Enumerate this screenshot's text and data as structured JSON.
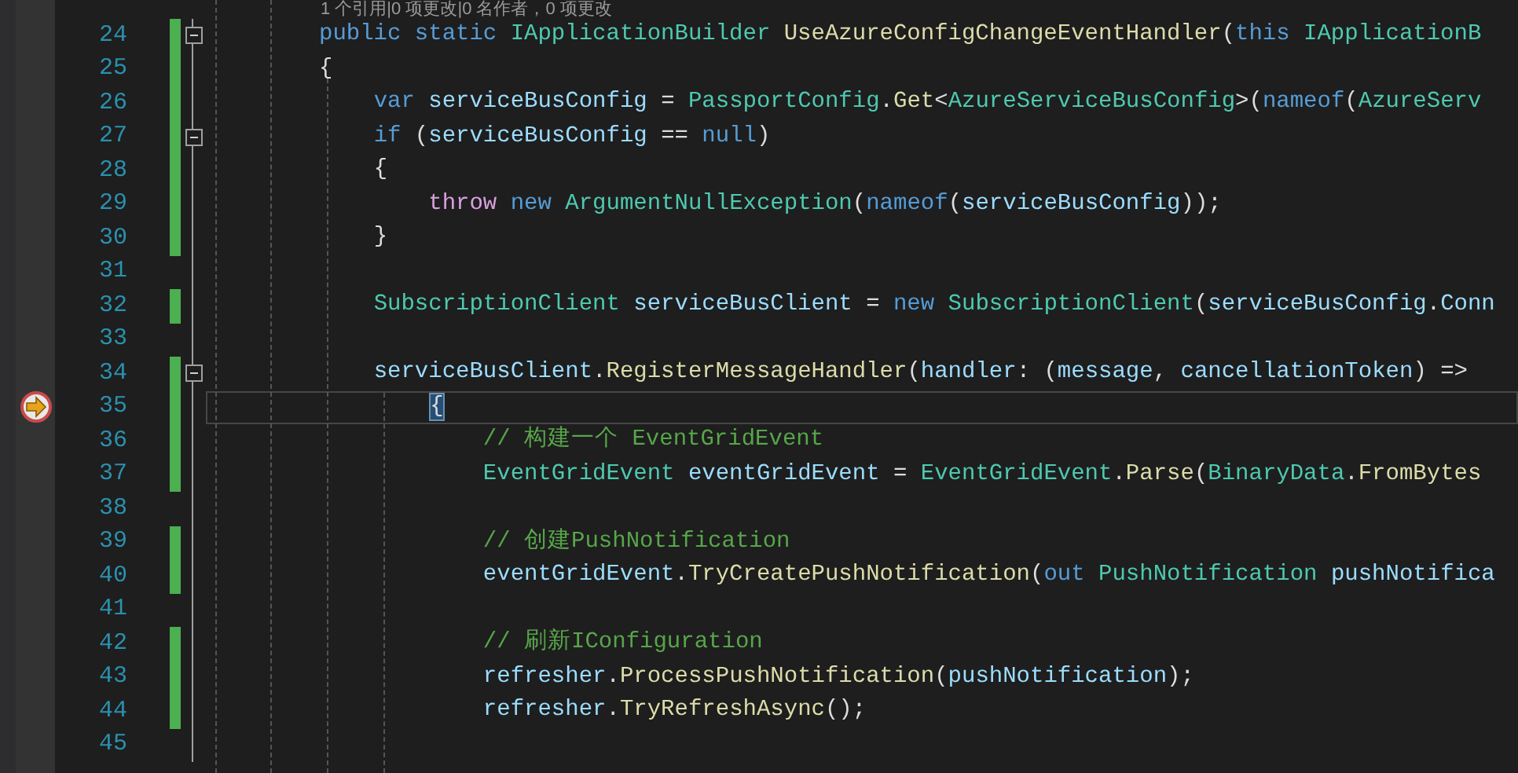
{
  "codelens": "1 个引用|0 项更改|0 名作者，0 项更改",
  "lines": [
    {
      "number": "24",
      "changed": true,
      "fold": true,
      "current": false,
      "tokens": [
        {
          "kind": "keyword",
          "text": "public static "
        },
        {
          "kind": "type",
          "text": "IApplicationBuilder "
        },
        {
          "kind": "method",
          "text": "UseAzureConfigChangeEventHandler"
        },
        {
          "kind": "plain",
          "text": "("
        },
        {
          "kind": "keyword",
          "text": "this "
        },
        {
          "kind": "type",
          "text": "IApplicationB"
        }
      ]
    },
    {
      "number": "25",
      "changed": true,
      "fold": false,
      "current": false,
      "tokens": [
        {
          "kind": "plain",
          "text": "{"
        }
      ]
    },
    {
      "number": "26",
      "changed": true,
      "fold": false,
      "current": false,
      "tokens": [
        {
          "kind": "keyword",
          "text": "    var "
        },
        {
          "kind": "variable",
          "text": "serviceBusConfig"
        },
        {
          "kind": "plain",
          "text": " = "
        },
        {
          "kind": "type",
          "text": "PassportConfig"
        },
        {
          "kind": "plain",
          "text": "."
        },
        {
          "kind": "method",
          "text": "Get"
        },
        {
          "kind": "plain",
          "text": "<"
        },
        {
          "kind": "type",
          "text": "AzureServiceBusConfig"
        },
        {
          "kind": "plain",
          "text": ">("
        },
        {
          "kind": "keyword",
          "text": "nameof"
        },
        {
          "kind": "plain",
          "text": "("
        },
        {
          "kind": "type",
          "text": "AzureServ"
        }
      ]
    },
    {
      "number": "27",
      "changed": true,
      "fold": true,
      "current": false,
      "tokens": [
        {
          "kind": "keyword",
          "text": "    if "
        },
        {
          "kind": "plain",
          "text": "("
        },
        {
          "kind": "variable",
          "text": "serviceBusConfig"
        },
        {
          "kind": "plain",
          "text": " == "
        },
        {
          "kind": "keyword",
          "text": "null"
        },
        {
          "kind": "plain",
          "text": ")"
        }
      ]
    },
    {
      "number": "28",
      "changed": true,
      "fold": false,
      "current": false,
      "tokens": [
        {
          "kind": "plain",
          "text": "    {"
        }
      ]
    },
    {
      "number": "29",
      "changed": true,
      "fold": false,
      "current": false,
      "tokens": [
        {
          "kind": "control",
          "text": "        throw "
        },
        {
          "kind": "keyword",
          "text": "new "
        },
        {
          "kind": "type",
          "text": "ArgumentNullException"
        },
        {
          "kind": "plain",
          "text": "("
        },
        {
          "kind": "keyword",
          "text": "nameof"
        },
        {
          "kind": "plain",
          "text": "("
        },
        {
          "kind": "variable",
          "text": "serviceBusConfig"
        },
        {
          "kind": "plain",
          "text": "));"
        }
      ]
    },
    {
      "number": "30",
      "changed": true,
      "fold": false,
      "current": false,
      "tokens": [
        {
          "kind": "plain",
          "text": "    }"
        }
      ]
    },
    {
      "number": "31",
      "changed": false,
      "fold": false,
      "current": false
    },
    {
      "number": "32",
      "changed": true,
      "fold": false,
      "current": false,
      "tokens": [
        {
          "kind": "type",
          "text": "    SubscriptionClient "
        },
        {
          "kind": "variable",
          "text": "serviceBusClient"
        },
        {
          "kind": "plain",
          "text": " = "
        },
        {
          "kind": "keyword",
          "text": "new "
        },
        {
          "kind": "type",
          "text": "SubscriptionClient"
        },
        {
          "kind": "plain",
          "text": "("
        },
        {
          "kind": "variable",
          "text": "serviceBusConfig"
        },
        {
          "kind": "plain",
          "text": "."
        },
        {
          "kind": "variable",
          "text": "Conn"
        }
      ]
    },
    {
      "number": "33",
      "changed": false,
      "fold": false,
      "current": false
    },
    {
      "number": "34",
      "changed": true,
      "fold": true,
      "current": false,
      "tokens": [
        {
          "kind": "variable",
          "text": "    serviceBusClient"
        },
        {
          "kind": "plain",
          "text": "."
        },
        {
          "kind": "method",
          "text": "RegisterMessageHandler"
        },
        {
          "kind": "plain",
          "text": "("
        },
        {
          "kind": "variable",
          "text": "handler"
        },
        {
          "kind": "plain",
          "text": ": ("
        },
        {
          "kind": "variable",
          "text": "message"
        },
        {
          "kind": "plain",
          "text": ", "
        },
        {
          "kind": "variable",
          "text": "cancellationToken"
        },
        {
          "kind": "plain",
          "text": ") =>"
        }
      ]
    },
    {
      "number": "35",
      "changed": true,
      "fold": false,
      "current": true,
      "tokens": [
        {
          "kind": "brace-match",
          "text": "        {"
        }
      ]
    },
    {
      "number": "36",
      "changed": true,
      "fold": false,
      "current": false,
      "tokens": [
        {
          "kind": "comment",
          "text": "            // 构建一个 EventGridEvent"
        }
      ]
    },
    {
      "number": "37",
      "changed": true,
      "fold": false,
      "current": false,
      "tokens": [
        {
          "kind": "type",
          "text": "            EventGridEvent "
        },
        {
          "kind": "variable",
          "text": "eventGridEvent"
        },
        {
          "kind": "plain",
          "text": " = "
        },
        {
          "kind": "type",
          "text": "EventGridEvent"
        },
        {
          "kind": "plain",
          "text": "."
        },
        {
          "kind": "method",
          "text": "Parse"
        },
        {
          "kind": "plain",
          "text": "("
        },
        {
          "kind": "type",
          "text": "BinaryData"
        },
        {
          "kind": "plain",
          "text": "."
        },
        {
          "kind": "method",
          "text": "FromBytes"
        }
      ]
    },
    {
      "number": "38",
      "changed": false,
      "fold": false,
      "current": false
    },
    {
      "number": "39",
      "changed": true,
      "fold": false,
      "current": false,
      "tokens": [
        {
          "kind": "comment",
          "text": "            // 创建PushNotification"
        }
      ]
    },
    {
      "number": "40",
      "changed": true,
      "fold": false,
      "current": false,
      "tokens": [
        {
          "kind": "variable",
          "text": "            eventGridEvent"
        },
        {
          "kind": "plain",
          "text": "."
        },
        {
          "kind": "method",
          "text": "TryCreatePushNotification"
        },
        {
          "kind": "plain",
          "text": "("
        },
        {
          "kind": "keyword",
          "text": "out "
        },
        {
          "kind": "type",
          "text": "PushNotification "
        },
        {
          "kind": "variable",
          "text": "pushNotifica"
        }
      ]
    },
    {
      "number": "41",
      "changed": false,
      "fold": false,
      "current": false
    },
    {
      "number": "42",
      "changed": true,
      "fold": false,
      "current": false,
      "tokens": [
        {
          "kind": "comment",
          "text": "            // 刷新IConfiguration"
        }
      ]
    },
    {
      "number": "43",
      "changed": true,
      "fold": false,
      "current": false,
      "tokens": [
        {
          "kind": "variable",
          "text": "            refresher"
        },
        {
          "kind": "plain",
          "text": "."
        },
        {
          "kind": "method",
          "text": "ProcessPushNotification"
        },
        {
          "kind": "plain",
          "text": "("
        },
        {
          "kind": "variable",
          "text": "pushNotification"
        },
        {
          "kind": "plain",
          "text": ");"
        }
      ]
    },
    {
      "number": "44",
      "changed": true,
      "fold": false,
      "current": false,
      "tokens": [
        {
          "kind": "variable",
          "text": "            refresher"
        },
        {
          "kind": "plain",
          "text": "."
        },
        {
          "kind": "method",
          "text": "TryRefreshAsync"
        },
        {
          "kind": "plain",
          "text": "();"
        }
      ]
    },
    {
      "number": "45",
      "changed": false,
      "fold": false,
      "current": false
    }
  ]
}
